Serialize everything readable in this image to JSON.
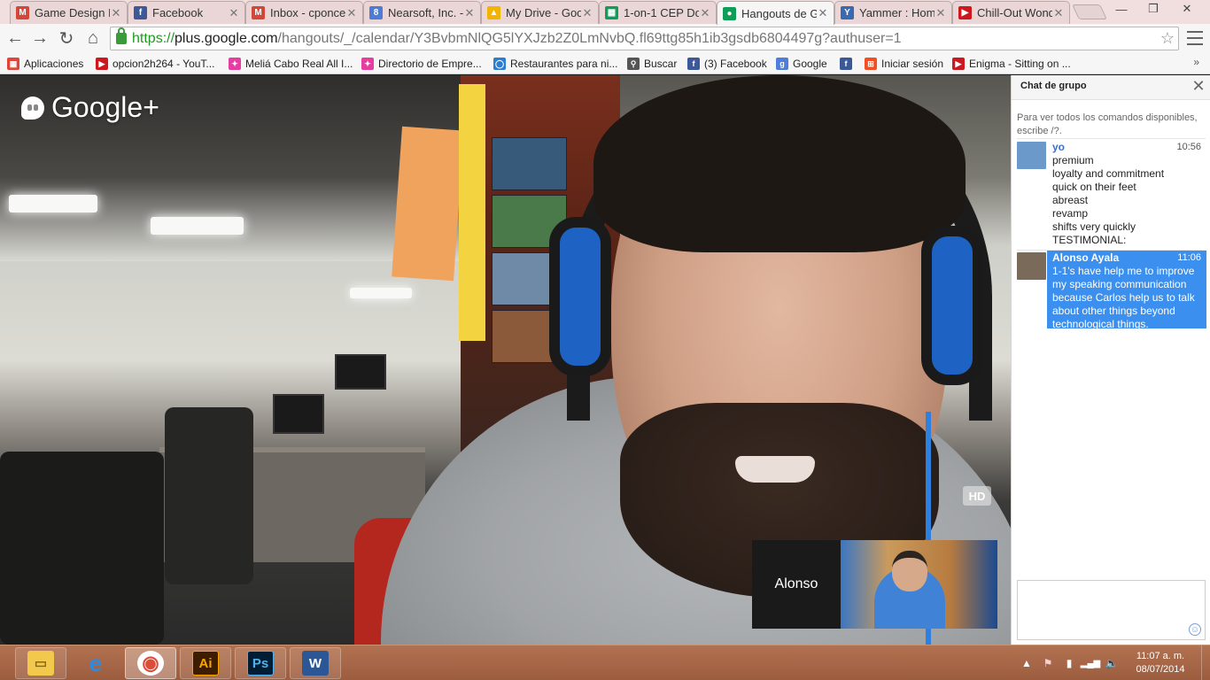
{
  "browser": {
    "tabs": [
      {
        "title": "Game Design F",
        "icon": "gmail-icon",
        "color": "#d44638",
        "glyph": "M"
      },
      {
        "title": "Facebook",
        "icon": "facebook-icon",
        "color": "#3b5998",
        "glyph": "f"
      },
      {
        "title": "Inbox - cponce",
        "icon": "gmail-icon",
        "color": "#d44638",
        "glyph": "M"
      },
      {
        "title": "Nearsoft, Inc. -",
        "icon": "sites-icon",
        "color": "#4e7bd6",
        "glyph": "8"
      },
      {
        "title": "My Drive - Goo",
        "icon": "drive-icon",
        "color": "#f2b400",
        "glyph": "▲"
      },
      {
        "title": "1-on-1 CEP Do",
        "icon": "sheets-icon",
        "color": "#0f9d58",
        "glyph": "▦"
      },
      {
        "title": "Hangouts de G",
        "icon": "hangouts-icon",
        "color": "#0f9d58",
        "glyph": "●"
      },
      {
        "title": "Yammer : Hom",
        "icon": "yammer-icon",
        "color": "#396ab1",
        "glyph": "Y"
      },
      {
        "title": "Chill-Out Wond",
        "icon": "youtube-icon",
        "color": "#cc181e",
        "glyph": "▶"
      }
    ],
    "active_tab": 6,
    "url": {
      "scheme": "https://",
      "host": "plus.google.com",
      "path": "/hangouts/_/calendar/Y3BvbmNlQG5lYXJzb2Z0LmNvbQ.fl69ttg85h1ib3gsdb6804497g?authuser=1"
    },
    "window_controls": {
      "minimize": "—",
      "restore": "❐",
      "close": "✕"
    },
    "nav": {
      "back": "←",
      "forward": "→",
      "reload": "↻",
      "home": "⌂",
      "star": "☆"
    },
    "bookmarks": [
      {
        "label": "Aplicaciones",
        "icon": "apps-grid-icon",
        "color": "#e0443b",
        "glyph": "▦"
      },
      {
        "label": "opcion2h264 - YouT...",
        "icon": "youtube-icon",
        "color": "#cc181e",
        "glyph": "▶"
      },
      {
        "label": "Meliá Cabo Real All I...",
        "icon": "melia-icon",
        "color": "#e53ea0",
        "glyph": "✦"
      },
      {
        "label": "Directorio de Empre...",
        "icon": "melia-icon",
        "color": "#e53ea0",
        "glyph": "✦"
      },
      {
        "label": "Restaurantes para ni...",
        "icon": "ring-icon",
        "color": "#2a7fd4",
        "glyph": "◯"
      },
      {
        "label": "Buscar",
        "icon": "search-icon",
        "color": "#555555",
        "glyph": "⚲"
      },
      {
        "label": "(3) Facebook",
        "icon": "facebook-icon",
        "color": "#3b5998",
        "glyph": "f"
      },
      {
        "label": "Google",
        "icon": "google-icon",
        "color": "#4f7ddb",
        "glyph": "g"
      },
      {
        "label": "",
        "icon": "facebook-icon",
        "color": "#3b5998",
        "glyph": "f"
      },
      {
        "label": "Iniciar sesión",
        "icon": "windows-icon",
        "color": "#f25022",
        "glyph": "⊞"
      },
      {
        "label": "Enigma - Sitting on ...",
        "icon": "youtube-icon",
        "color": "#cc181e",
        "glyph": "▶"
      }
    ],
    "bookmarks_more": "»"
  },
  "hangout": {
    "logo_text": "Google+",
    "hd_badge": "HD",
    "self_view_name": "Alonso"
  },
  "chat": {
    "title": "Chat de grupo",
    "close": "✕",
    "help_text": "Para ver todos los comandos disponibles, escribe /?.",
    "messages": [
      {
        "sender": "yo",
        "time": "10:56",
        "lines": [
          "premium",
          "loyalty and commitment",
          "quick on their feet",
          "abreast",
          "revamp",
          "shifts very quickly",
          "TESTIMONIAL:"
        ],
        "selected": false
      },
      {
        "sender": "Alonso Ayala",
        "time": "11:06",
        "lines": [
          "1-1's have help me to improve",
          "my speaking communication",
          "because Carlos help us to talk",
          "about other things beyond",
          "technological things."
        ],
        "selected": true
      }
    ],
    "emoji": "☺"
  },
  "taskbar": {
    "apps": [
      {
        "name": "explorer",
        "icon": "folder-icon",
        "glyph": "▭",
        "color": "#f2c94c",
        "state": "pinned"
      },
      {
        "name": "ie",
        "icon": "internet-explorer-icon",
        "glyph": "e",
        "color": "#2a8ae4",
        "state": "plain"
      },
      {
        "name": "chrome",
        "icon": "chrome-icon",
        "glyph": "◉",
        "color": "#dd4b39",
        "state": "active"
      },
      {
        "name": "illustrator",
        "icon": "illustrator-icon",
        "glyph": "Ai",
        "color": "#f7a600",
        "state": "pinned"
      },
      {
        "name": "photoshop",
        "icon": "photoshop-icon",
        "glyph": "Ps",
        "color": "#4fb2f0",
        "state": "pinned"
      },
      {
        "name": "word",
        "icon": "word-icon",
        "glyph": "W",
        "color": "#2b5797",
        "state": "pinned"
      }
    ],
    "tray": {
      "chevron": "▲",
      "flag": "⚑",
      "network": "▮",
      "signal": "▂▄▆",
      "volume": "🔈"
    },
    "time": "11:07 a. m.",
    "date": "08/07/2014"
  }
}
